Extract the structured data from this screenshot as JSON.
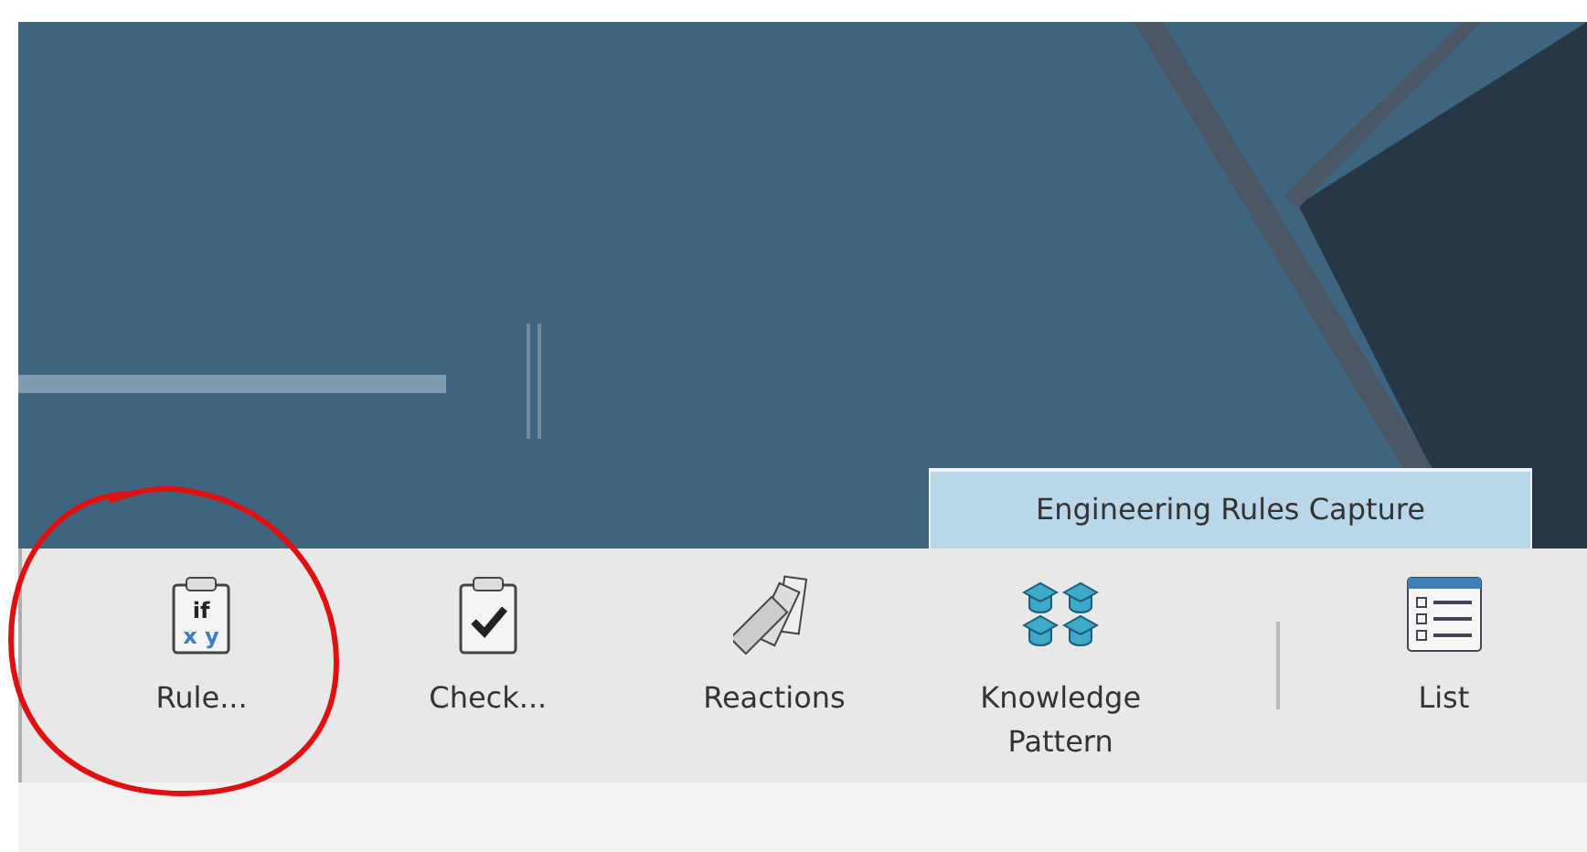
{
  "workbench_tab": {
    "label": "Engineering Rules Capture",
    "selected": true
  },
  "tools": [
    {
      "kind": "rule",
      "icon_text": [
        "if",
        "x y"
      ],
      "label": "Rule...",
      "circled": true,
      "separator_before": false
    },
    {
      "kind": "check",
      "label": "Check...",
      "circled": false,
      "separator_before": false
    },
    {
      "kind": "reactions",
      "label": "Reactions",
      "circled": false,
      "separator_before": false
    },
    {
      "kind": "knowledge_pattern",
      "label": "Knowledge Pattern",
      "circled": false,
      "separator_before": false
    },
    {
      "kind": "list",
      "label": "List",
      "circled": false,
      "separator_before": true
    }
  ]
}
